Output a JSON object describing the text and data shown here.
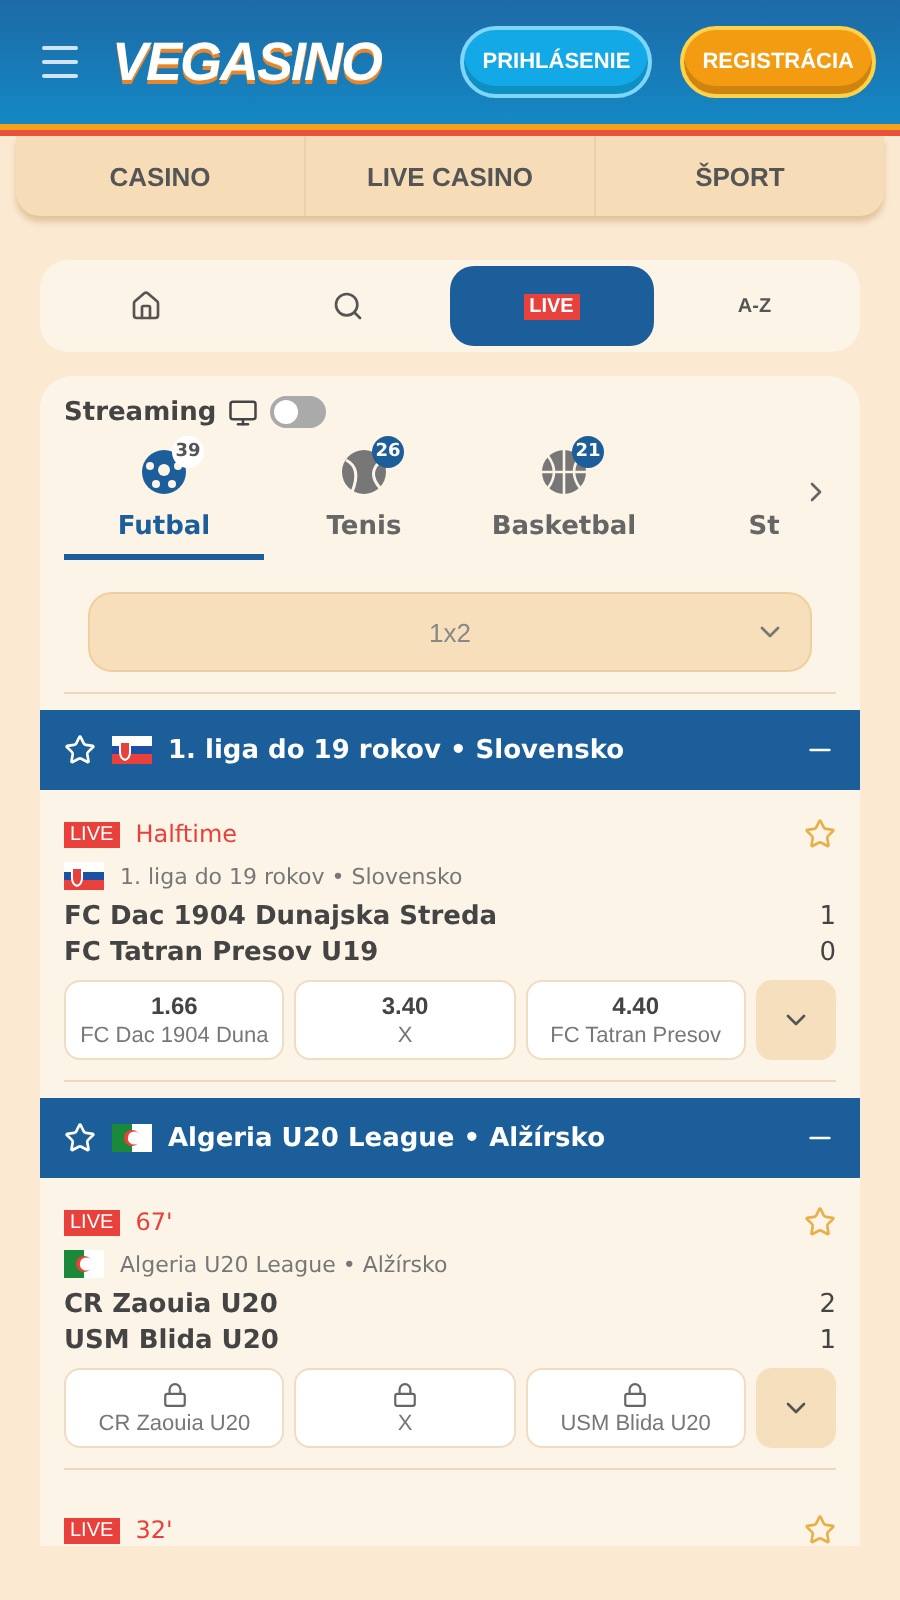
{
  "header": {
    "logo": "VEGASINO",
    "login": "PRIHLÁSENIE",
    "register": "REGISTRÁCIA"
  },
  "main_nav": [
    {
      "label": "CASINO",
      "selected": false
    },
    {
      "label": "LIVE CASINO",
      "selected": false
    },
    {
      "label": "ŠPORT",
      "selected": false
    }
  ],
  "quick_nav": [
    {
      "kind": "home",
      "selected": false
    },
    {
      "kind": "search",
      "selected": false
    },
    {
      "kind": "live",
      "label": "LIVE",
      "selected": true
    },
    {
      "kind": "text",
      "label": "A-Z",
      "selected": false
    }
  ],
  "streaming": {
    "label": "Streaming",
    "on": false
  },
  "sports": [
    {
      "kind": "football",
      "label": "Futbal",
      "count": "39",
      "selected": true
    },
    {
      "kind": "tennis",
      "label": "Tenis",
      "count": "26",
      "selected": false
    },
    {
      "kind": "basketball",
      "label": "Basketbal",
      "count": "21",
      "selected": false
    },
    {
      "kind": "none",
      "label": "St",
      "selected": false
    }
  ],
  "market_select": {
    "value": "1x2"
  },
  "leagues": [
    {
      "title": "1. liga do 19 rokov • Slovensko",
      "flag": {
        "kind": "sk"
      },
      "favorite": false,
      "matches": [
        {
          "live": "LIVE",
          "status": "Halftime",
          "favorite": false,
          "flag": {
            "kind": "sk"
          },
          "league": "1. liga do 19 rokov • Slovensko",
          "home": "FC Dac 1904 Dunajska Streda",
          "away": "FC Tatran Presov U19",
          "home_score": "1",
          "away_score": "0",
          "odds": [
            {
              "price": "1.66",
              "label": "FC Dac 1904 Duna",
              "locked": false
            },
            {
              "price": "3.40",
              "label": "X",
              "locked": false
            },
            {
              "price": "4.40",
              "label": "FC Tatran Presov",
              "locked": false
            }
          ]
        }
      ]
    },
    {
      "title": "Algeria U20 League • Alžírsko",
      "flag": {
        "kind": "dz"
      },
      "favorite": false,
      "matches": [
        {
          "live": "LIVE",
          "status": "67'",
          "favorite": false,
          "flag": {
            "kind": "dz"
          },
          "league": "Algeria U20 League • Alžírsko",
          "home": "CR Zaouia U20",
          "away": "USM Blida U20",
          "home_score": "2",
          "away_score": "1",
          "odds": [
            {
              "label": "CR Zaouia U20",
              "locked": true
            },
            {
              "label": "X",
              "locked": true
            },
            {
              "label": "USM Blida U20",
              "locked": true
            }
          ]
        },
        {
          "live": "LIVE",
          "status": "32'",
          "favorite": false
        }
      ]
    }
  ]
}
